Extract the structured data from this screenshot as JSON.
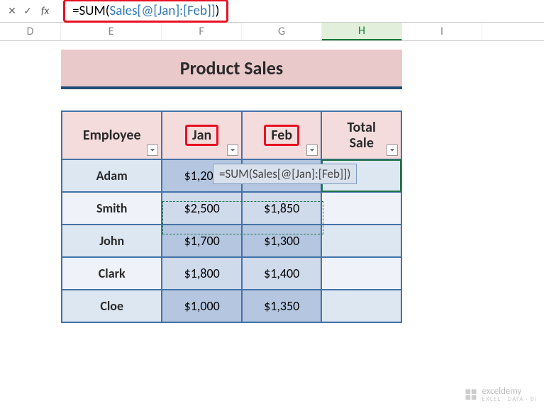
{
  "formula_bar": {
    "eq": "=",
    "fn": "SUM",
    "open": "(",
    "ref": "Sales[@[Jan]:[Feb]]",
    "close": ")"
  },
  "columns": {
    "D": "D",
    "E": "E",
    "F": "F",
    "G": "G",
    "H": "H",
    "I": "I"
  },
  "title": "Product Sales",
  "headers": {
    "employee": "Employee",
    "jan": "Jan",
    "feb": "Feb",
    "total1": "Total",
    "total2": "Sale"
  },
  "rows": [
    {
      "emp": "Adam",
      "jan": "$1,200",
      "feb": "",
      "tot": ""
    },
    {
      "emp": "Smith",
      "jan": "$2,500",
      "feb": "$1,850",
      "tot": ""
    },
    {
      "emp": "John",
      "jan": "$1,700",
      "feb": "$1,300",
      "tot": ""
    },
    {
      "emp": "Clark",
      "jan": "$1,800",
      "feb": "$1,400",
      "tot": ""
    },
    {
      "emp": "Cloe",
      "jan": "$1,000",
      "feb": "$1,350",
      "tot": ""
    }
  ],
  "tooltip": "=SUM(Sales[@[Jan]:[Feb]])",
  "watermark": {
    "brand": "exceldemy",
    "sub": "EXCEL · DATA · BI"
  }
}
